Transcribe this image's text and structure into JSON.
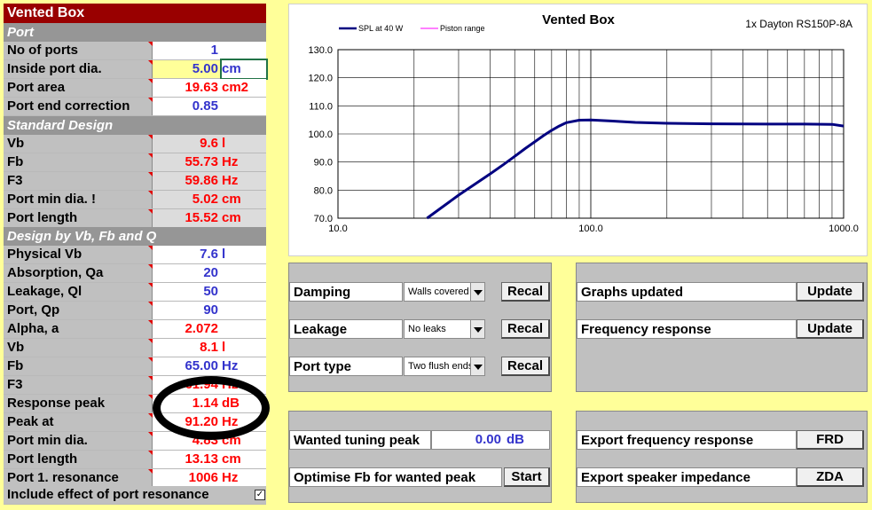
{
  "sheet": {
    "title": "Vented Box",
    "sections": {
      "port": "Port",
      "standard": "Standard Design",
      "design": "Design by Vb, Fb and Q"
    },
    "rows": [
      {
        "label": "No of ports",
        "value": "1",
        "unit": "",
        "color": "blue"
      },
      {
        "label": "Inside port dia.",
        "value": "5.00",
        "unit": "cm",
        "color": "blue"
      },
      {
        "label": "Port area",
        "value": "19.63",
        "unit": "cm2",
        "color": "red"
      },
      {
        "label": "Port end correction",
        "value": "0.85",
        "unit": "",
        "color": "blue"
      },
      {
        "label": "Vb",
        "value": "9.6",
        "unit": "l",
        "color": "red"
      },
      {
        "label": "Fb",
        "value": "55.73",
        "unit": "Hz",
        "color": "red"
      },
      {
        "label": "F3",
        "value": "59.86",
        "unit": "Hz",
        "color": "red"
      },
      {
        "label": "Port min dia. !",
        "value": "5.02",
        "unit": "cm",
        "color": "red"
      },
      {
        "label": "Port length",
        "value": "15.52",
        "unit": "cm",
        "color": "red"
      },
      {
        "label": "Physical Vb",
        "value": "7.6",
        "unit": "l",
        "color": "blue"
      },
      {
        "label": "Absorption, Qa",
        "value": "20",
        "unit": "",
        "color": "blue"
      },
      {
        "label": "Leakage, Ql",
        "value": "50",
        "unit": "",
        "color": "blue"
      },
      {
        "label": "Port, Qp",
        "value": "90",
        "unit": "",
        "color": "blue"
      },
      {
        "label": "Alpha, a",
        "value": "2.072",
        "unit": "",
        "color": "red"
      },
      {
        "label": "Vb",
        "value": "8.1",
        "unit": "l",
        "color": "red"
      },
      {
        "label": "Fb",
        "value": "65.00",
        "unit": "Hz",
        "color": "blue"
      },
      {
        "label": "F3",
        "value": "61.94",
        "unit": "Hz",
        "color": "red"
      },
      {
        "label": "Response peak",
        "value": "1.14",
        "unit": "dB",
        "color": "red"
      },
      {
        "label": "Peak at",
        "value": "91.20",
        "unit": "Hz",
        "color": "red"
      },
      {
        "label": "Port min dia.",
        "value": "4.83",
        "unit": "cm",
        "color": "red"
      },
      {
        "label": "Port length",
        "value": "13.13",
        "unit": "cm",
        "color": "red"
      },
      {
        "label": "Port 1. resonance",
        "value": "1006",
        "unit": "Hz",
        "color": "red"
      }
    ],
    "include_label": "Include effect of port resonance",
    "include_checked": "✓"
  },
  "chart_data": {
    "type": "line",
    "title": "Vented Box",
    "subtitle": "1x Dayton RS150P-8A",
    "x_scale": "log",
    "xlim": [
      10,
      1000
    ],
    "ylim": [
      70,
      130
    ],
    "x_ticks": [
      "10.0",
      "100.0",
      "1000.0"
    ],
    "y_ticks": [
      "70.0",
      "80.0",
      "90.0",
      "100.0",
      "110.0",
      "120.0",
      "130.0"
    ],
    "grid": true,
    "legend_position": "top-left",
    "series": [
      {
        "name": "SPL at 40 W",
        "color": "#000080",
        "x": [
          22.5,
          25,
          30,
          35,
          40,
          45,
          50,
          55,
          60,
          65,
          70,
          75,
          80,
          90,
          100,
          120,
          150,
          200,
          300,
          500,
          700,
          900,
          1000
        ],
        "y": [
          70.0,
          73.0,
          78.2,
          82.3,
          85.8,
          89.0,
          92.0,
          94.8,
          97.2,
          99.4,
          101.3,
          102.8,
          104.0,
          104.9,
          105.0,
          104.6,
          104.1,
          103.8,
          103.6,
          103.5,
          103.5,
          103.4,
          102.8
        ]
      },
      {
        "name": "Piston range",
        "color": "#ff00ff",
        "x": [],
        "y": []
      }
    ]
  },
  "controls": {
    "damping": {
      "label": "Damping",
      "selected": "Walls covered",
      "button": "Recal"
    },
    "leakage": {
      "label": "Leakage",
      "selected": "No leaks",
      "button": "Recal"
    },
    "port_type": {
      "label": "Port type",
      "selected": "Two flush ends",
      "button": "Recal"
    },
    "graphs_updated": {
      "label": "Graphs updated",
      "button": "Update"
    },
    "frequency_response": {
      "label": "Frequency response",
      "button": "Update"
    },
    "wanted_peak": {
      "label": "Wanted tuning peak",
      "value": "0.00",
      "unit": "dB"
    },
    "optimise": {
      "label": "Optimise Fb for wanted peak",
      "button": "Start"
    },
    "export_frd": {
      "label": "Export frequency response",
      "button": "FRD"
    },
    "export_zda": {
      "label": "Export speaker impedance",
      "button": "ZDA"
    }
  },
  "colors": {
    "title_bar": "#990000",
    "section": "#969696",
    "label_bg": "#c0c0c0",
    "background": "#ffff99",
    "value_blue": "#3333cc",
    "value_red": "#ff0000"
  }
}
